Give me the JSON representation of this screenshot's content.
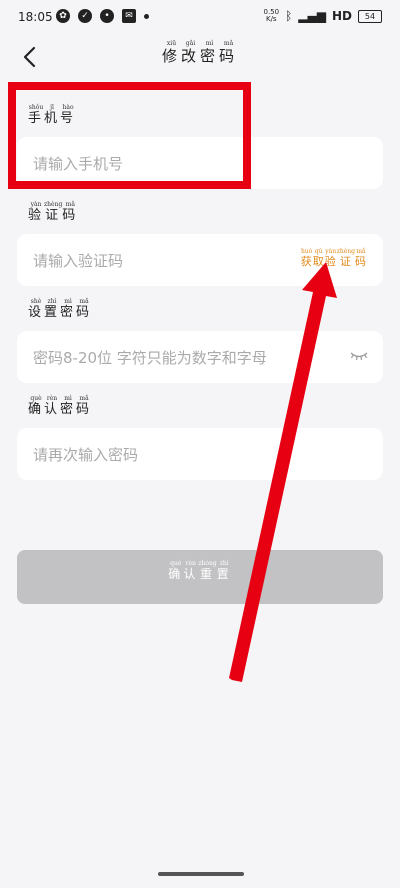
{
  "status": {
    "time": "18:05",
    "speed_top": "0.50",
    "speed_bottom": "K/s",
    "network": "HD",
    "battery": "54"
  },
  "header": {
    "title": [
      {
        "c": "修",
        "p": "xiū"
      },
      {
        "c": "改",
        "p": "gǎi"
      },
      {
        "c": "密",
        "p": "mì"
      },
      {
        "c": "码",
        "p": "mǎ"
      }
    ]
  },
  "fields": {
    "phone": {
      "label": [
        {
          "c": "手",
          "p": "shǒu"
        },
        {
          "c": "机",
          "p": "jī"
        },
        {
          "c": "号",
          "p": "hào"
        }
      ],
      "placeholder": "请输入手机号"
    },
    "code": {
      "label": [
        {
          "c": "验",
          "p": "yàn"
        },
        {
          "c": "证",
          "p": "zhèng"
        },
        {
          "c": "码",
          "p": "mǎ"
        }
      ],
      "placeholder": "请输入验证码",
      "get_code": [
        {
          "c": "获",
          "p": "huò"
        },
        {
          "c": "取",
          "p": "qǔ"
        },
        {
          "c": "验",
          "p": "yàn"
        },
        {
          "c": "证",
          "p": "zhèng"
        },
        {
          "c": "码",
          "p": "mǎ"
        }
      ]
    },
    "password": {
      "label": [
        {
          "c": "设",
          "p": "shè"
        },
        {
          "c": "置",
          "p": "zhì"
        },
        {
          "c": "密",
          "p": "mì"
        },
        {
          "c": "码",
          "p": "mǎ"
        }
      ],
      "placeholder": "密码8-20位 字符只能为数字和字母"
    },
    "confirm": {
      "label": [
        {
          "c": "确",
          "p": "què"
        },
        {
          "c": "认",
          "p": "rèn"
        },
        {
          "c": "密",
          "p": "mì"
        },
        {
          "c": "码",
          "p": "mǎ"
        }
      ],
      "placeholder": "请再次输入密码"
    }
  },
  "button": {
    "confirm_reset": [
      {
        "c": "确",
        "p": "què"
      },
      {
        "c": "认",
        "p": "rèn"
      },
      {
        "c": "重",
        "p": "zhòng"
      },
      {
        "c": "置",
        "p": "zhì"
      }
    ]
  },
  "colors": {
    "accent_orange": "#e08a1c",
    "annotation_red": "#e60012",
    "button_disabled": "#c2c2c4"
  }
}
